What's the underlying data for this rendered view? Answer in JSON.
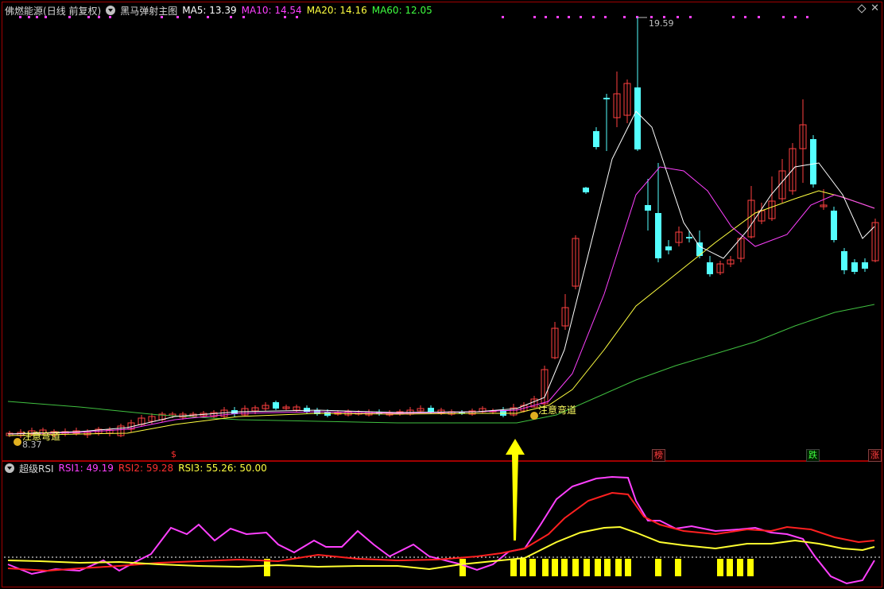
{
  "main_header": {
    "stock_name": "佛燃能源",
    "period_mode": "(日线 前复权)",
    "indicator_name": "黑马弹射主图",
    "ma5_label": "MA5: 13.39",
    "ma10_label": "MA10: 14.54",
    "ma20_label": "MA20: 14.16",
    "ma60_label": "MA60: 12.05"
  },
  "rsi_header": {
    "indicator_name": "超级RSI",
    "rsi1_label": "RSI1: 49.19",
    "rsi2_label": "RSI2: 59.28",
    "rsi3_label": "RSI3: 55.26",
    "ref_label": ": 50.00"
  },
  "annotations": {
    "left_signal": "注意弯道",
    "right_signal": "注意弯道",
    "low_price": "8.37",
    "high_price": "19.59",
    "dollar_mark": "$",
    "badge_bang": "榜",
    "badge_die": "跌",
    "badge_zhang": "涨"
  },
  "colors": {
    "up": "#ff4040",
    "down": "#54ffff",
    "ma5": "#ffffff",
    "ma10": "#ff40ff",
    "ma20": "#ffff40",
    "ma60": "#40c040",
    "rsi1": "#ff40ff",
    "rsi2": "#ff2020",
    "rsi3": "#ffff30",
    "arrow": "#ffff00",
    "bars": "#ffff00"
  },
  "icons": {
    "collapse": "chevron-down-icon",
    "diamond": "diamond-icon",
    "close": "close-icon"
  }
}
